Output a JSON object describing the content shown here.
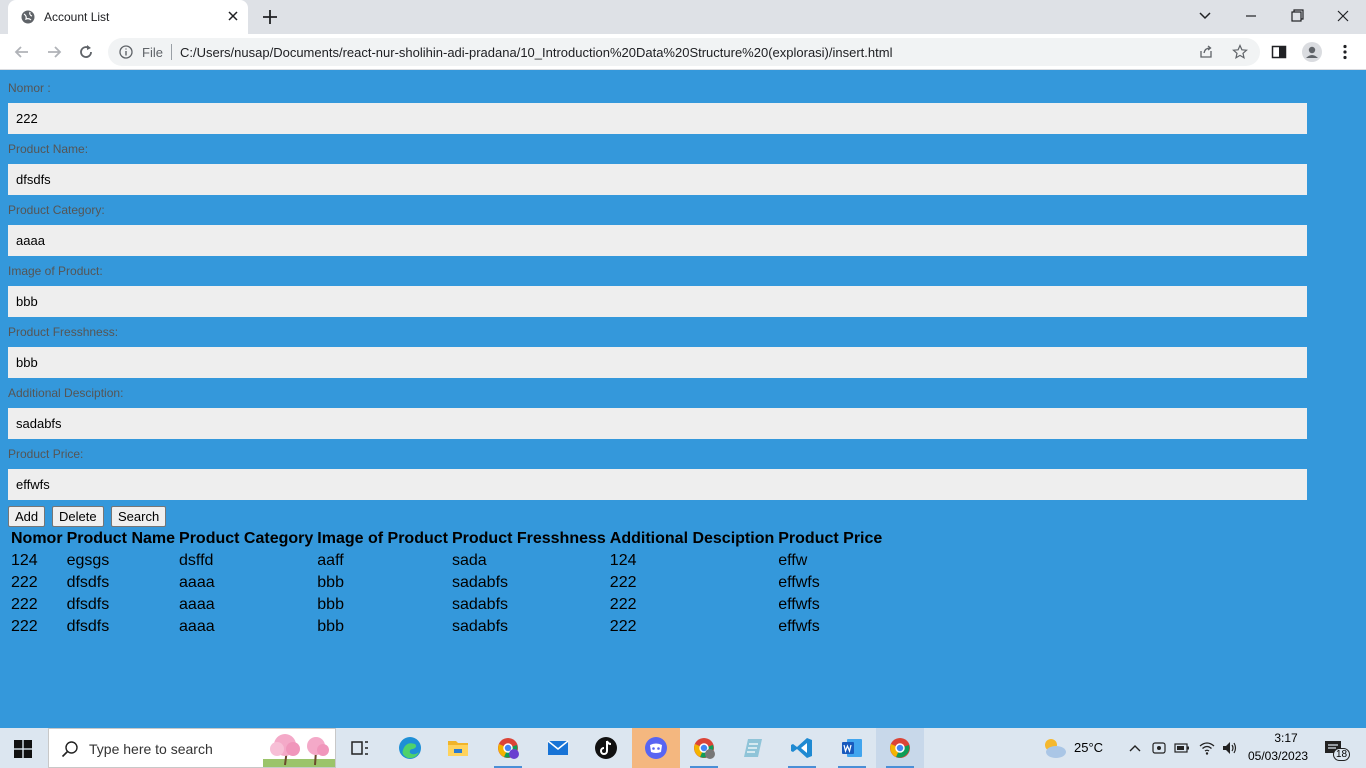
{
  "browser": {
    "tab_title": "Account List",
    "file_label": "File",
    "url": "C:/Users/nusap/Documents/react-nur-sholihin-adi-pradana/10_Introduction%20Data%20Structure%20(explorasi)/insert.html"
  },
  "form": {
    "fields": [
      {
        "label": "Nomor :",
        "value": "222"
      },
      {
        "label": "Product Name:",
        "value": "dfsdfs"
      },
      {
        "label": "Product Category:",
        "value": "aaaa"
      },
      {
        "label": "Image of Product:",
        "value": "bbb"
      },
      {
        "label": "Product Fresshness:",
        "value": "bbb"
      },
      {
        "label": "Additional Desciption:",
        "value": "sadabfs"
      },
      {
        "label": "Product Price:",
        "value": "effwfs"
      }
    ],
    "buttons": {
      "add": "Add",
      "delete": "Delete",
      "search": "Search"
    }
  },
  "table": {
    "headers": [
      "Nomor",
      "Product Name",
      "Product Category",
      "Image of Product",
      "Product Fresshness",
      "Additional Desciption",
      "Product Price"
    ],
    "rows": [
      [
        "124",
        "egsgs",
        "dsffd",
        "aaff",
        "sada",
        "124",
        "effw"
      ],
      [
        "222",
        "dfsdfs",
        "aaaa",
        "bbb",
        "sadabfs",
        "222",
        "effwfs"
      ],
      [
        "222",
        "dfsdfs",
        "aaaa",
        "bbb",
        "sadabfs",
        "222",
        "effwfs"
      ],
      [
        "222",
        "dfsdfs",
        "aaaa",
        "bbb",
        "sadabfs",
        "222",
        "effwfs"
      ]
    ]
  },
  "taskbar": {
    "search_placeholder": "Type here to search",
    "weather": "25°C",
    "time": "3:17",
    "date": "05/03/2023",
    "notifications": "18",
    "apps": [
      "task-view-icon",
      "edge-icon",
      "file-explorer-icon",
      "chrome-profile-icon",
      "mail-icon",
      "tiktok-icon",
      "discord-icon",
      "chrome-profile-2-icon",
      "notepad-icon",
      "vscode-icon",
      "word-icon",
      "chrome-icon"
    ]
  },
  "colors": {
    "page_bg": "#3498db",
    "input_bg": "#eeeeee",
    "label": "#555555"
  }
}
